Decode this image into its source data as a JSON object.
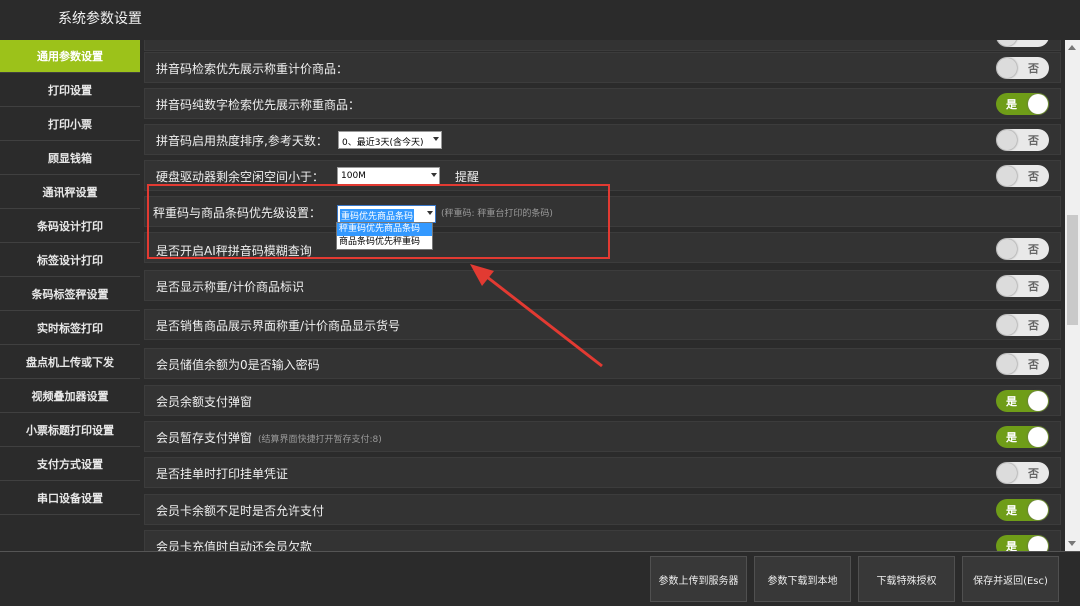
{
  "window": {
    "title": "系统参数设置"
  },
  "sidebar": {
    "items": [
      {
        "label": "通用参数设置",
        "active": true
      },
      {
        "label": "打印设置"
      },
      {
        "label": "打印小票"
      },
      {
        "label": "顾显钱箱"
      },
      {
        "label": "通讯秤设置"
      },
      {
        "label": "条码设计打印"
      },
      {
        "label": "标签设计打印"
      },
      {
        "label": "条码标签秤设置"
      },
      {
        "label": "实时标签打印"
      },
      {
        "label": "盘点机上传或下发"
      },
      {
        "label": "视频叠加器设置"
      },
      {
        "label": "小票标题打印设置"
      },
      {
        "label": "支付方式设置"
      },
      {
        "label": "串口设备设置"
      }
    ]
  },
  "settings": {
    "rows": [
      {
        "label": "拼音码检索优先展示称重计价商品：",
        "toggle": "否"
      },
      {
        "label": "拼音码纯数字检索优先展示称重商品：",
        "toggle": "是"
      },
      {
        "label": "拼音码启用热度排序,参考天数：",
        "select": "0、最近3天(含今天)",
        "toggle": "否"
      },
      {
        "label": "硬盘驱动器剩余空闲空间小于：",
        "select": "100M",
        "suffix": "提醒",
        "toggle": "否"
      },
      {
        "label": "秤重码与商品条码优先级设置：",
        "select": "重码优先商品条码",
        "hint": "(秤重码: 秤重台打印的条码)"
      },
      {
        "label": "是否开启AI秤拼音码模糊查询",
        "toggle": "否"
      },
      {
        "label": "是否显示称重/计价商品标识",
        "toggle": "否"
      },
      {
        "label": "是否销售商品展示界面称重/计价商品显示货号",
        "toggle": "否"
      },
      {
        "label": "会员储值余额为0是否输入密码",
        "toggle": "否"
      },
      {
        "label": "会员余额支付弹窗",
        "toggle": "是"
      },
      {
        "label": "会员暂存支付弹窗",
        "hint": "(结算界面快捷打开暂存支付:8)",
        "toggle": "是"
      },
      {
        "label": "是否挂单时打印挂单凭证",
        "toggle": "否"
      },
      {
        "label": "会员卡余额不足时是否允许支付",
        "toggle": "是"
      },
      {
        "label": "会员卡充值时自动还会员欠款",
        "toggle": "是"
      }
    ],
    "dropdown_options": [
      "秤重码优先商品条码",
      "商品条码优先秤重码"
    ],
    "dropdown_selected": "秤重码优先商品条码"
  },
  "footer": {
    "upload": "参数上传到服务器",
    "download": "参数下载到本地",
    "special": "下载特殊授权",
    "save": "保存并返回(Esc)"
  },
  "colors": {
    "accent": "#9cc21a",
    "toggle_on": "#6f9d18",
    "highlight": "#e23a32"
  }
}
